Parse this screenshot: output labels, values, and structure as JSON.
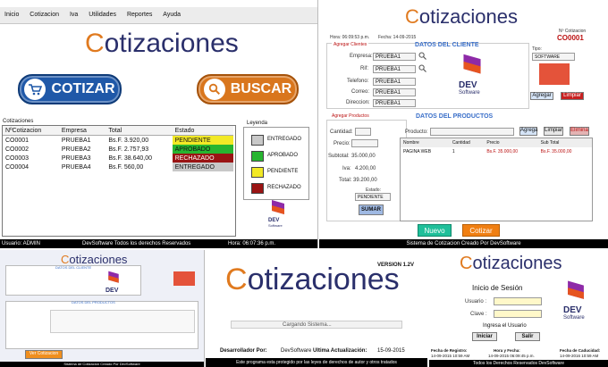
{
  "main": {
    "menu": [
      "Inicio",
      "Cotizacion",
      "Iva",
      "Utilidades",
      "Reportes",
      "Ayuda"
    ],
    "logo": "Cotizaciones",
    "btn_cotizar": "COTIZAR",
    "btn_buscar": "BUSCAR",
    "table_title": "Cotizaciones",
    "columns": [
      "NºCotizacion",
      "Empresa",
      "Total",
      "Estado"
    ],
    "rows": [
      {
        "num": "CO0001",
        "empresa": "PRUEBA1",
        "total": "Bs.F. 3.920,00",
        "estado": "PENDIENTE",
        "color": "#f2e926"
      },
      {
        "num": "CO0002",
        "empresa": "PRUEBA2",
        "total": "Bs.F. 2.757,93",
        "estado": "APROBADO",
        "color": "#27b530"
      },
      {
        "num": "CO0003",
        "empresa": "PRUEBA3",
        "total": "Bs.F. 38.640,00",
        "estado": "RECHAZADO",
        "color": "#9a1414"
      },
      {
        "num": "CO0004",
        "empresa": "PRUEBA4",
        "total": "Bs.F. 560,00",
        "estado": "ENTREGADO",
        "color": "#c8c8c8"
      }
    ],
    "legend_title": "Leyenda",
    "legend": [
      {
        "label": "ENTREGADO",
        "color": "#c8c8c8"
      },
      {
        "label": "APROBADO",
        "color": "#27b530"
      },
      {
        "label": "PENDIENTE",
        "color": "#f2e926"
      },
      {
        "label": "RECHAZADO",
        "color": "#9a1414"
      }
    ],
    "dev_text": "DEV",
    "dev_sub": "Software",
    "status_user": "Usuario: ADMIN",
    "status_rights": "DevSoftware Todos los derechos Reservados",
    "status_time": "Hora: 06:07:36 p.m."
  },
  "quote": {
    "logo": "Cotizaciones",
    "hora": "Hora: 06:09:53 p.m.",
    "fecha": "Fecha: 14-09-2015",
    "ncot_label": "Nº Cotizacion",
    "ncot": "CO0001",
    "agregar_clientes": "Agregar Clientes",
    "datos_cliente": "DATOS DEL CLIENTE",
    "empresa_label": "Empresa:",
    "empresa": "PRUEBA1",
    "rif_label": "Rif:",
    "rif": "PRUEBA1",
    "telefono_label": "Telefono:",
    "telefono": "PRUEBA1",
    "correo_label": "Correo:",
    "correo": "PRUEBA1",
    "direccion_label": "Direccion:",
    "direccion": "PRUEBA1",
    "tipo_label": "Tipo:",
    "tipo": "SOFTWARE",
    "btn_agregar": "Agregar",
    "btn_limpiar": "Limpiar",
    "agregar_productos": "Agregar Productos",
    "datos_productos": "DATOS DEL PRODUCTOS",
    "producto_label": "Producto:",
    "btn_agrega": "Agrega",
    "btn_limpiar2": "Limpiar",
    "btn_elimina": "Elimina",
    "cantidad_label": "Cantidad:",
    "precio_label": "Precio:",
    "subtotal_label": "Subtotal:",
    "subtotal": "35.000,00",
    "iva_label": "Iva:",
    "iva": "4.200,00",
    "total_label": "Total:",
    "total": "39.200,00",
    "estado_label": "Estado:",
    "estado": "PENDIENTE",
    "btn_sumar": "SUMAR",
    "prod_columns": [
      "Nombre",
      "Cantidad",
      "Precio",
      "Sub Total"
    ],
    "prod_row": [
      "PAGINA WEB",
      "1",
      "Bs.F. 35.000,00",
      "Bs.F. 35.000,00"
    ],
    "btn_nuevo": "Nuevo",
    "btn_cotizar": "Cotizar",
    "status": "Sistema de Cotizacion Creado Por DevSoftware"
  },
  "splash": {
    "version": "VERSION 1.2V",
    "logo": "Cotizaciones",
    "loading": "Cargando Sistema...",
    "dev_label": "Desarrollador Por:",
    "dev_value": "DevSoftware",
    "update_label": "Ultima Actualización:",
    "update_value": "15-09-2015",
    "footer": "Este programa esta protegido por las leyes de derechos de autor y otros tratados"
  },
  "login": {
    "logo": "Cotizaciones",
    "title": "Inicio de Sesión",
    "usuario_label": "Usuario :",
    "clave_label": "Clave :",
    "hint": "Ingresa el Usuario",
    "btn_iniciar": "Iniciar",
    "btn_salir": "Salir",
    "reg_label": "Fecha de Registro:",
    "reg_value": "14-09-2015 10:59 AM",
    "hora_label": "Hora y Fecha:",
    "hora_value": "14-09-2015 06:09:45 p.m.",
    "cad_label": "Fecha de Caducidad:",
    "cad_value": "14-09-2016 10:59 AM",
    "footer": "Todos los Derechos Reservados   DevSoftware"
  },
  "thumb": {
    "logo": "Cotizaciones",
    "datos_cliente": "DATOS DEL CLIENTE",
    "datos_productos": "DATOS DEL PRODUCTOS",
    "btn_ver": "Ver Cotizacion",
    "footer": "Sistema de Cotizacion Creado Por DevSoftware"
  }
}
